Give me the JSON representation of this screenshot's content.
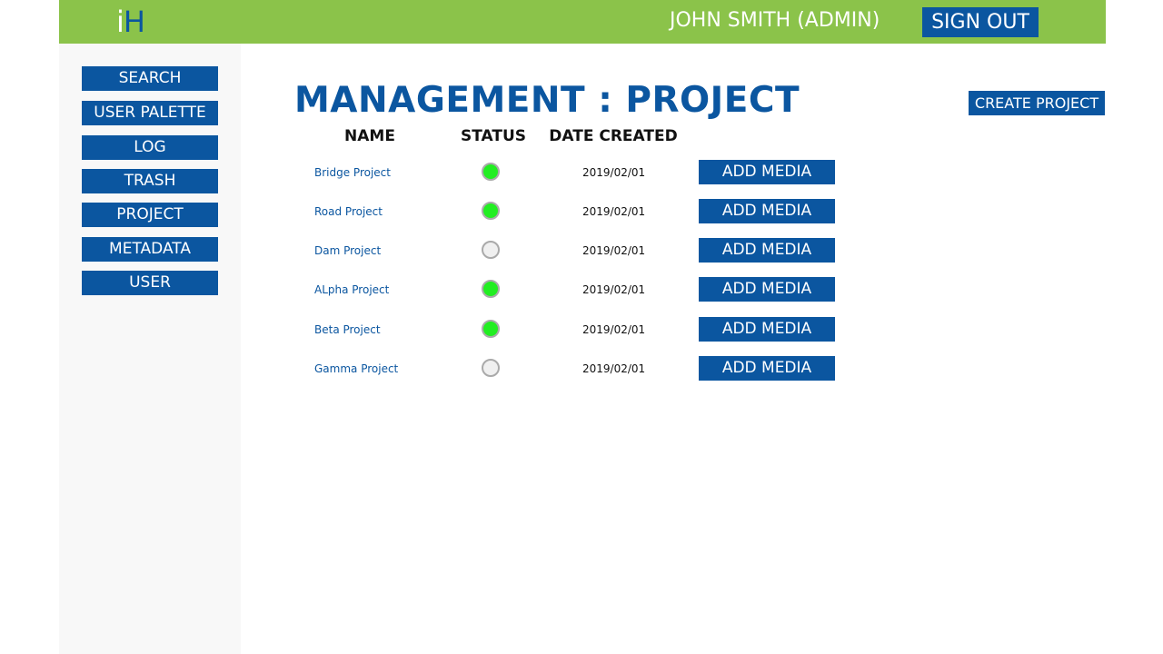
{
  "header": {
    "logo_i": "i",
    "logo_h": "H",
    "user": "JOHN SMITH (ADMIN)",
    "sign_out": "SIGN OUT"
  },
  "sidebar": {
    "items": [
      {
        "label": "SEARCH"
      },
      {
        "label": "USER PALETTE"
      },
      {
        "label": "LOG"
      },
      {
        "label": "TRASH"
      },
      {
        "label": "PROJECT"
      },
      {
        "label": "METADATA"
      },
      {
        "label": "USER"
      }
    ]
  },
  "main": {
    "title": "MANAGEMENT : PROJECT",
    "create_button": "CREATE PROJECT",
    "columns": {
      "name": "NAME",
      "status": "STATUS",
      "date": "DATE CREATED"
    },
    "rows": [
      {
        "name": "Bridge Project",
        "status": "active",
        "date": "2019/02/01",
        "action": "ADD MEDIA"
      },
      {
        "name": "Road Project",
        "status": "active",
        "date": "2019/02/01",
        "action": "ADD MEDIA"
      },
      {
        "name": "Dam Project",
        "status": "inactive",
        "date": "2019/02/01",
        "action": "ADD MEDIA"
      },
      {
        "name": "ALpha Project",
        "status": "active",
        "date": "2019/02/01",
        "action": "ADD MEDIA"
      },
      {
        "name": "Beta Project",
        "status": "active",
        "date": "2019/02/01",
        "action": "ADD MEDIA"
      },
      {
        "name": "Gamma Project",
        "status": "inactive",
        "date": "2019/02/01",
        "action": "ADD MEDIA"
      }
    ]
  },
  "colors": {
    "header_bg": "#8bc34a",
    "accent": "#0b56a0",
    "sidebar_bg": "#f8f8f8",
    "status_active": "#22ee22",
    "status_inactive": "#f0f0f0"
  }
}
